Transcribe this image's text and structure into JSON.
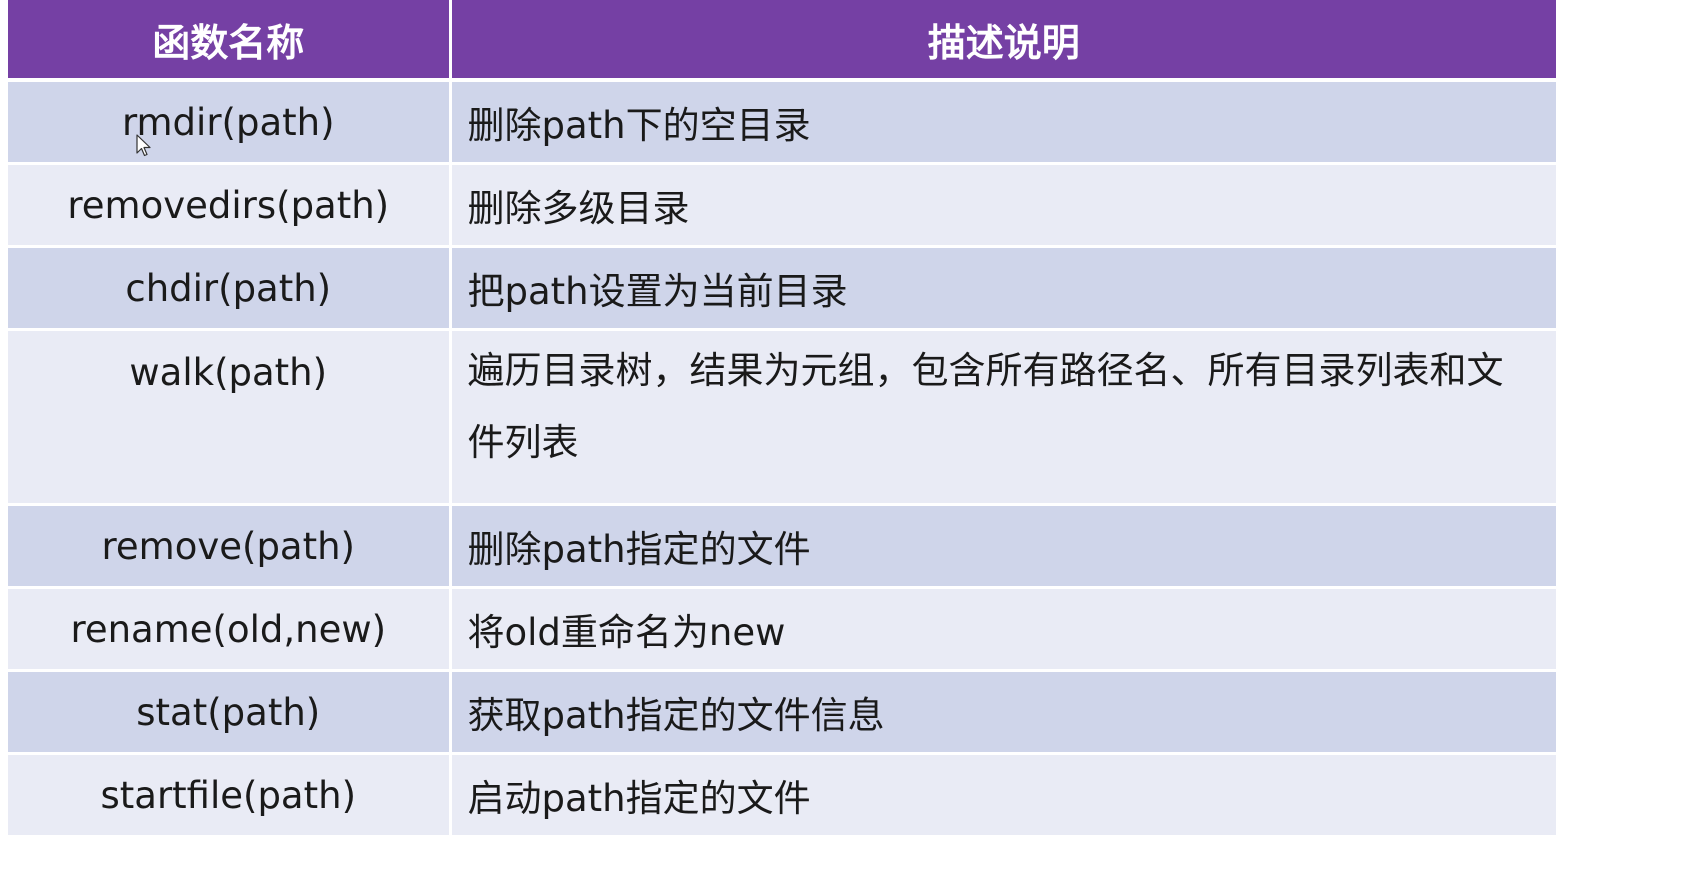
{
  "table": {
    "headers": [
      "函数名称",
      "描述说明"
    ],
    "rows": [
      {
        "fn": "rmdir(path)",
        "desc": "删除path下的空目录"
      },
      {
        "fn": "removedirs(path)",
        "desc": "删除多级目录"
      },
      {
        "fn": "chdir(path)",
        "desc": "把path设置为当前目录"
      },
      {
        "fn": "walk(path)",
        "desc": "遍历目录树，结果为元组，包含所有路径名、所有目录列表和文件列表"
      },
      {
        "fn": "remove(path)",
        "desc": "删除path指定的文件"
      },
      {
        "fn": "rename(old,new)",
        "desc": "将old重命名为new"
      },
      {
        "fn": "stat(path)",
        "desc": "获取path指定的文件信息"
      },
      {
        "fn": "startfile(path)",
        "desc": "启动path指定的文件"
      }
    ]
  },
  "colors": {
    "header_bg": "#7540a4",
    "row_odd": "#cfd5ea",
    "row_even": "#e9ebf5"
  },
  "icons": {
    "cursor": "mouse-pointer-icon"
  }
}
